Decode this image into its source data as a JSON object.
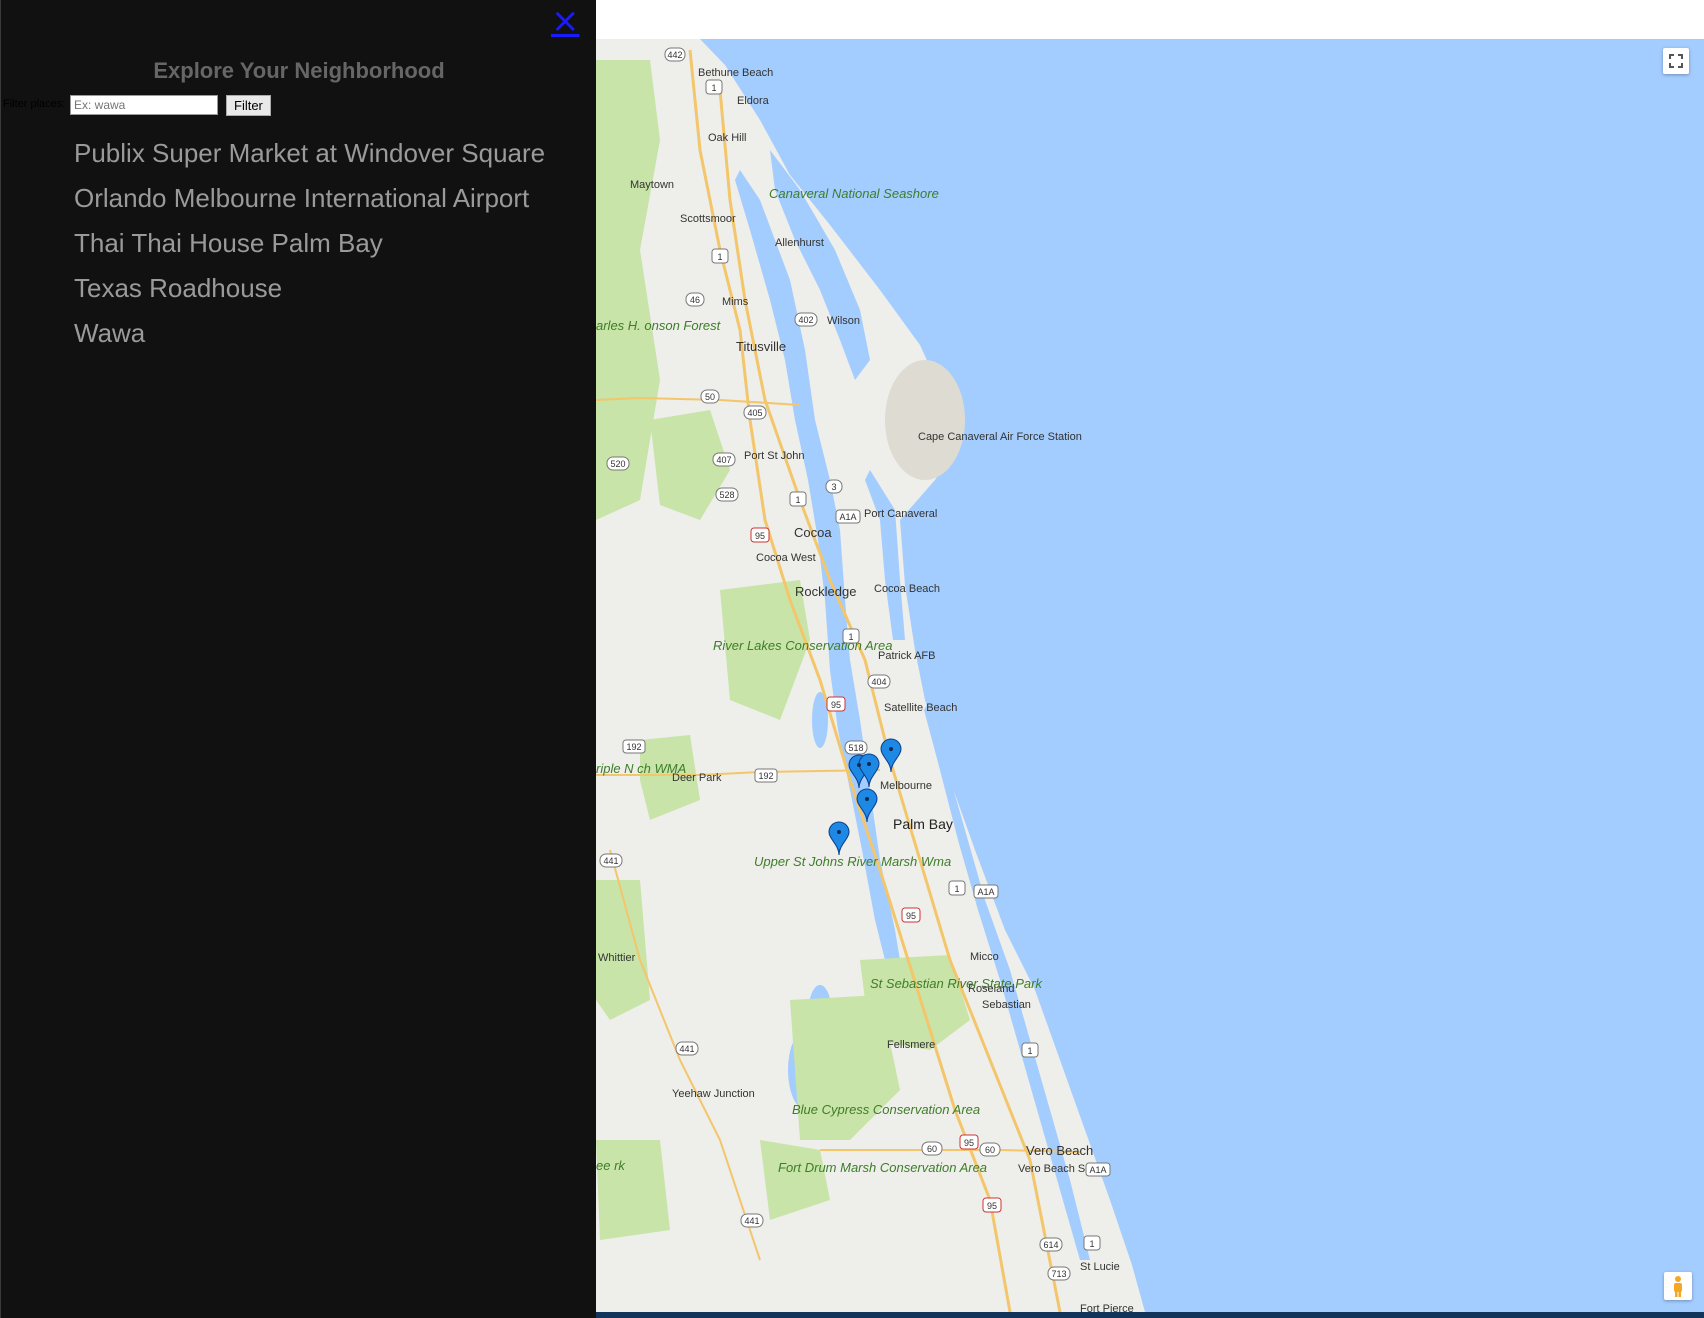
{
  "sidebar": {
    "close_glyph": "×",
    "title": "Explore Your Neighborhood",
    "filter_label": "Filter places:",
    "filter_placeholder": "Ex: wawa",
    "filter_button": "Filter",
    "places": [
      "Publix Super Market at Windover Square",
      "Orlando Melbourne International Airport",
      "Thai Thai House Palm Bay",
      "Texas Roadhouse",
      "Wawa"
    ]
  },
  "map": {
    "colors": {
      "water": "#a3ccff",
      "land": "#eeeeea",
      "park": "#c8e4a8",
      "road": "#f3c66b",
      "marker": "#1e88e5"
    },
    "labels": {
      "bethune_beach": "Bethune Beach",
      "eldora": "Eldora",
      "oak_hill": "Oak Hill",
      "maytown": "Maytown",
      "scottsmoor": "Scottsmoor",
      "canaveral_seashore": "Canaveral National Seashore",
      "allenhurst": "Allenhurst",
      "mims": "Mims",
      "wilson": "Wilson",
      "charles_forest": "arles H. onson Forest",
      "titusville": "Titusville",
      "port_st_john": "Port St John",
      "cape_canaveral_afs": "Cape Canaveral Air Force Station",
      "port_canaveral": "Port Canaveral",
      "cocoa": "Cocoa",
      "cocoa_west": "Cocoa West",
      "rockledge": "Rockledge",
      "cocoa_beach": "Cocoa Beach",
      "river_lakes": "River Lakes Conservation Area",
      "patrick_afb": "Patrick AFB",
      "satellite_beach": "Satellite Beach",
      "deer_park": "Deer Park",
      "triple_n": "riple N ch WMA",
      "melbourne": "Melbourne",
      "palm_bay": "Palm Bay",
      "upper_st_johns": "Upper St Johns River Marsh Wma",
      "micco": "Micco",
      "whittier": "Whittier",
      "roseland": "Roseland",
      "sebastian": "Sebastian",
      "st_sebastian": "St Sebastian River State Park",
      "fellsmere": "Fellsmere",
      "yeehaw": "Yeehaw Junction",
      "blue_cypress": "Blue Cypress Conservation Area",
      "vero_beach": "Vero Beach",
      "vero_beach_south": "Vero Beach South",
      "fort_drum": "Fort Drum Marsh Conservation Area",
      "st_lucie": "St Lucie",
      "fort_pierce": "Fort Pierce",
      "ee_rk": "ee rk"
    },
    "shields": [
      "442",
      "1",
      "1",
      "46",
      "402",
      "50",
      "405",
      "407",
      "520",
      "528",
      "3",
      "1",
      "A1A",
      "95",
      "1",
      "404",
      "95",
      "518",
      "192",
      "192",
      "441",
      "1",
      "A1A",
      "95",
      "441",
      "1",
      "60",
      "95",
      "60",
      "A1A",
      "441",
      "95",
      "614",
      "1",
      "713"
    ]
  }
}
